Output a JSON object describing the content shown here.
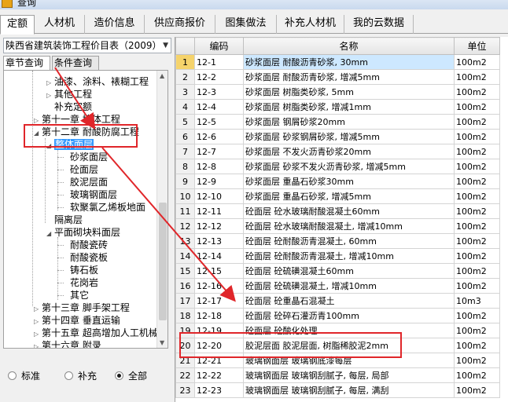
{
  "window": {
    "title": "查询"
  },
  "main_tabs": [
    "定额",
    "人材机",
    "造价信息",
    "供应商报价",
    "图集做法",
    "补充人材机",
    "我的云数据"
  ],
  "library_select": {
    "value": "陕西省建筑装饰工程价目表（2009）"
  },
  "sub_tabs": [
    "章节查询",
    "条件查询"
  ],
  "tree": [
    {
      "label": "油漆、涂料、裱糊工程"
    },
    {
      "label": "其他工程"
    },
    {
      "label": "补充定额"
    },
    {
      "label": "第十一章 墙体工程"
    },
    {
      "label": "第十二章 耐酸防腐工程"
    },
    {
      "label": "整体面层"
    },
    {
      "label": "砂浆面层"
    },
    {
      "label": "砼面层"
    },
    {
      "label": "胶泥层面"
    },
    {
      "label": "玻璃钢面层"
    },
    {
      "label": "软聚氯乙烯板地面"
    },
    {
      "label": "隔离层"
    },
    {
      "label": "平面砌块料面层"
    },
    {
      "label": "耐酸瓷砖"
    },
    {
      "label": "耐酸瓷板"
    },
    {
      "label": "铸石板"
    },
    {
      "label": "花岗岩"
    },
    {
      "label": "其它"
    },
    {
      "label": "第十三章 脚手架工程"
    },
    {
      "label": "第十四章 垂直运输"
    },
    {
      "label": "第十五章 超高增加人工机械"
    },
    {
      "label": "第十六章 附录"
    }
  ],
  "radio_options": [
    {
      "label": "标准",
      "checked": false
    },
    {
      "label": "补充",
      "checked": false
    },
    {
      "label": "全部",
      "checked": true
    }
  ],
  "grid": {
    "columns": [
      "编码",
      "名称",
      "单位"
    ],
    "rows": [
      [
        "1",
        "12-1",
        "砂浆面层 耐酸沥青砂浆, 30mm",
        "100m2"
      ],
      [
        "2",
        "12-2",
        "砂浆面层 耐酸沥青砂浆, 增减5mm",
        "100m2"
      ],
      [
        "3",
        "12-3",
        "砂浆面层 树脂类砂浆, 5mm",
        "100m2"
      ],
      [
        "4",
        "12-4",
        "砂浆面层 树脂类砂浆, 增减1mm",
        "100m2"
      ],
      [
        "5",
        "12-5",
        "砂浆面层 钢屑砂浆20mm",
        "100m2"
      ],
      [
        "6",
        "12-6",
        "砂浆面层 砂浆钢屑砂浆, 增减5mm",
        "100m2"
      ],
      [
        "7",
        "12-7",
        "砂浆面层 不发火沥青砂浆20mm",
        "100m2"
      ],
      [
        "8",
        "12-8",
        "砂浆面层 砂浆不发火沥青砂浆, 增减5mm",
        "100m2"
      ],
      [
        "9",
        "12-9",
        "砂浆面层 重晶石砂浆30mm",
        "100m2"
      ],
      [
        "10",
        "12-10",
        "砂浆面层 重晶石砂浆, 增减5mm",
        "100m2"
      ],
      [
        "11",
        "12-11",
        "砼面层 砼水玻璃耐酸混凝土60mm",
        "100m2"
      ],
      [
        "12",
        "12-12",
        "砼面层 砼水玻璃耐酸混凝土, 增减10mm",
        "100m2"
      ],
      [
        "13",
        "12-13",
        "砼面层 砼耐酸沥青混凝土, 60mm",
        "100m2"
      ],
      [
        "14",
        "12-14",
        "砼面层 砼耐酸沥青混凝土, 增减10mm",
        "100m2"
      ],
      [
        "15",
        "12-15",
        "砼面层 砼硫磺混凝土60mm",
        "100m2"
      ],
      [
        "16",
        "12-16",
        "砼面层 砼硫磺混凝土, 增减10mm",
        "100m2"
      ],
      [
        "17",
        "12-17",
        "砼面层 砼重晶石混凝土",
        "10m3"
      ],
      [
        "18",
        "12-18",
        "砼面层 砼碎石灌沥青100mm",
        "100m2"
      ],
      [
        "19",
        "12-19",
        "砼面层 砼酸化处理",
        "100m2"
      ],
      [
        "20",
        "12-20",
        "胶泥层面 胶泥层面, 树脂稀胶泥2mm",
        "100m2"
      ],
      [
        "21",
        "12-21",
        "玻璃钢面层 玻璃钢底漆每层",
        "100m2"
      ],
      [
        "22",
        "12-22",
        "玻璃钢面层 玻璃钢刮腻子, 每层, 局部",
        "100m2"
      ],
      [
        "23",
        "12-23",
        "玻璃钢面层 玻璃钢刮腻子, 每层, 满刮",
        "100m2"
      ]
    ]
  }
}
